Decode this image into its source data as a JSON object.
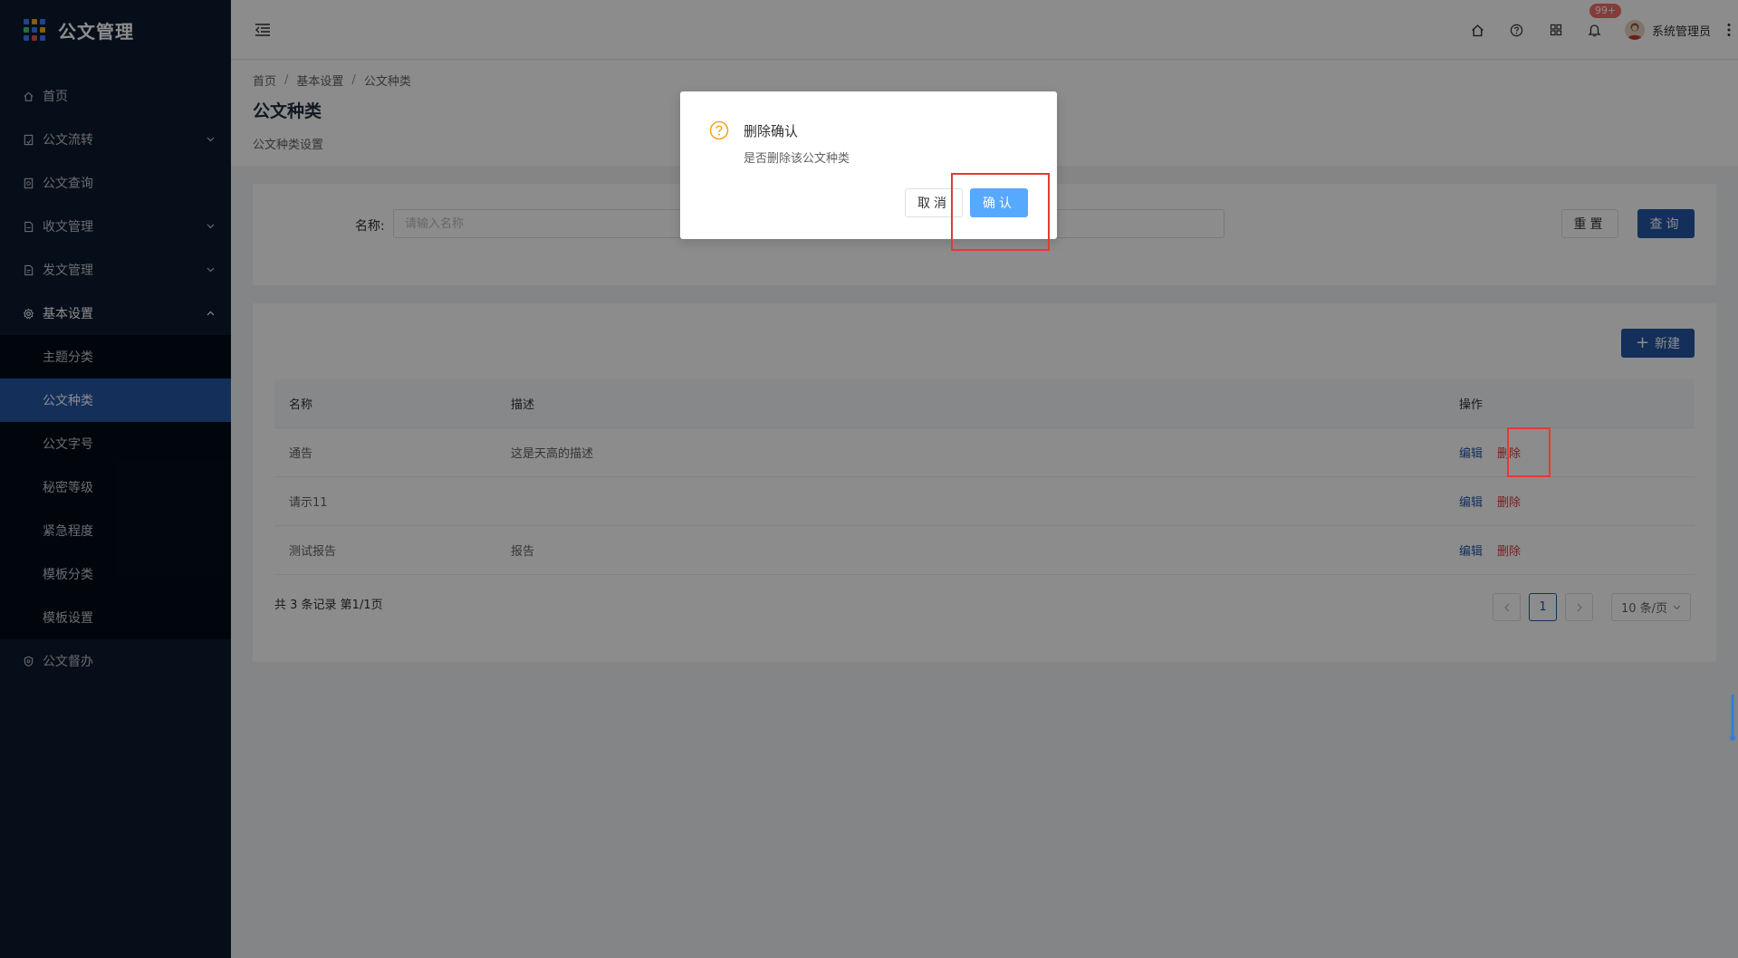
{
  "app": {
    "title": "公文管理"
  },
  "sidebar": {
    "items": [
      {
        "label": "首页",
        "icon": "home-icon"
      },
      {
        "label": "公文流转",
        "icon": "document-flow-icon",
        "expandable": true
      },
      {
        "label": "公文查询",
        "icon": "document-search-icon"
      },
      {
        "label": "收文管理",
        "icon": "inbox-document-icon",
        "expandable": true
      },
      {
        "label": "发文管理",
        "icon": "outbox-document-icon",
        "expandable": true
      },
      {
        "label": "基本设置",
        "icon": "gear-icon",
        "expandable": true,
        "open": true
      },
      {
        "label": "公文督办",
        "icon": "shield-icon"
      }
    ],
    "sub_items": [
      "主题分类",
      "公文种类",
      "公文字号",
      "秘密等级",
      "紧急程度",
      "模板分类",
      "模板设置"
    ],
    "active_sub": "公文种类"
  },
  "header": {
    "badge": "99+",
    "user_name": "系统管理员",
    "icons": [
      "home-icon",
      "help-icon",
      "grid-icon",
      "bell-icon"
    ]
  },
  "page": {
    "breadcrumb": [
      "首页",
      "基本设置",
      "公文种类"
    ],
    "title": "公文种类",
    "subtitle": "公文种类设置"
  },
  "search": {
    "label": "名称:",
    "placeholder": "请输入名称",
    "reset_label": "重置",
    "query_label": "查询"
  },
  "table": {
    "new_label": "新建",
    "columns": [
      "名称",
      "描述",
      "操作"
    ],
    "rows": [
      {
        "name": "通告",
        "desc": "这是天高的描述"
      },
      {
        "name": "请示11",
        "desc": ""
      },
      {
        "name": "测试报告",
        "desc": "报告"
      }
    ],
    "edit_label": "编辑",
    "delete_label": "删除"
  },
  "pagination": {
    "total_text": "共 3 条记录 第1/1页",
    "current_page": "1",
    "page_size": "10 条/页"
  },
  "dialog": {
    "title": "删除确认",
    "message": "是否删除该公文种类",
    "cancel_label": "取消",
    "confirm_label": "确认"
  },
  "colors": {
    "sidebar_bg": "#0b1a2e",
    "primary": "#2456a4",
    "danger": "#d9363e",
    "confirm_btn": "#57a8ff",
    "warning_icon": "#f5a623",
    "highlight": "#e53935"
  }
}
